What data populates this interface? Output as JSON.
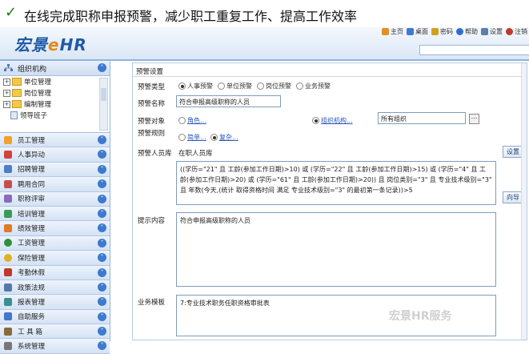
{
  "caption": {
    "text": "在线完成职称申报预警，减少职工重复工作、提高工作效率",
    "check": "✓"
  },
  "header": {
    "logo_left": "宏景",
    "logo_e": "e",
    "logo_right": "HR",
    "toolbar": [
      {
        "label": "主页",
        "icon": "home-icon",
        "color": "#e0902a"
      },
      {
        "label": "桌面",
        "icon": "desktop-icon",
        "color": "#3f7ad0"
      },
      {
        "label": "密码",
        "icon": "lock-icon",
        "color": "#d0a020"
      },
      {
        "label": "帮助",
        "icon": "help-icon",
        "color": "#2d6fcf"
      },
      {
        "label": "设置",
        "icon": "gear-icon",
        "color": "#5a7fa8"
      },
      {
        "label": "注销",
        "icon": "logout-icon",
        "color": "#c0392b"
      }
    ]
  },
  "sidebar": {
    "header": "组织机构",
    "tree": [
      {
        "label": "单位管理",
        "expandable": true
      },
      {
        "label": "岗位管理",
        "expandable": true
      },
      {
        "label": "编制管理",
        "expandable": true
      },
      {
        "label": "领导班子",
        "expandable": false
      }
    ],
    "menu": [
      {
        "label": "员工管理",
        "color": "#f0a030"
      },
      {
        "label": "人事异动",
        "color": "#d34040"
      },
      {
        "label": "招聘管理",
        "color": "#4d7fc4"
      },
      {
        "label": "聘用合同",
        "color": "#c44d4d"
      },
      {
        "label": "职称评审",
        "color": "#8a6bbf"
      },
      {
        "label": "培训管理",
        "color": "#3d9a5a"
      },
      {
        "label": "绩效管理",
        "color": "#e07a2a"
      },
      {
        "label": "工资管理",
        "color": "#2f8f3f"
      },
      {
        "label": "保险管理",
        "color": "#e0b020"
      },
      {
        "label": "考勤休假",
        "color": "#c0392b"
      },
      {
        "label": "政策法规",
        "color": "#5577aa"
      },
      {
        "label": "报表管理",
        "color": "#3a8f8f"
      },
      {
        "label": "自助服务",
        "color": "#4477cc"
      },
      {
        "label": "工 具 箱",
        "color": "#8a6a3a"
      },
      {
        "label": "系统管理",
        "color": "#777777"
      }
    ]
  },
  "form": {
    "section_title": "预警设置",
    "type_label": "预警类型",
    "type_options": [
      "人事预警",
      "单位预警",
      "岗位预警",
      "业务预警"
    ],
    "type_selected": 0,
    "name_label": "预警名称",
    "name_value": "符合申报高级职称的人员",
    "target_label": "预警对象",
    "target_role": "角色...",
    "target_org": "组织机构...",
    "target_org_selected": true,
    "org_value": "所有组织",
    "rule_label": "预警规则",
    "rule_simple": "简单...",
    "rule_complex": "复杂...",
    "rule_selected": "complex",
    "pool_label": "预警人员库",
    "pool_value": "在职人员库",
    "settings_button": "设置",
    "formula": "((学历=\"21\" 且 工龄(参加工作日期)>10) 或 (学历=\"22\" 且 工龄(参加工作日期)>15) 或 (学历=\"4\" 且 工龄(参加工作日期)>20) 或 (学历=\"61\" 且 工龄(参加工作日期)>20)) 且 岗位类别=\"3\" 且 专业技术级别=\"3\" 且 年数(今天,(统计 取得资格时间 满足 专业技术级别=\"3\" 的最初第一条记录))>5",
    "guide_button": "向导",
    "hint_label": "提示内容",
    "hint_value": "符合申报高级职称的人员",
    "template_label": "业务模板",
    "template_value": "7:专业技术职务任职资格审批表"
  },
  "watermark": "宏景HR服务"
}
